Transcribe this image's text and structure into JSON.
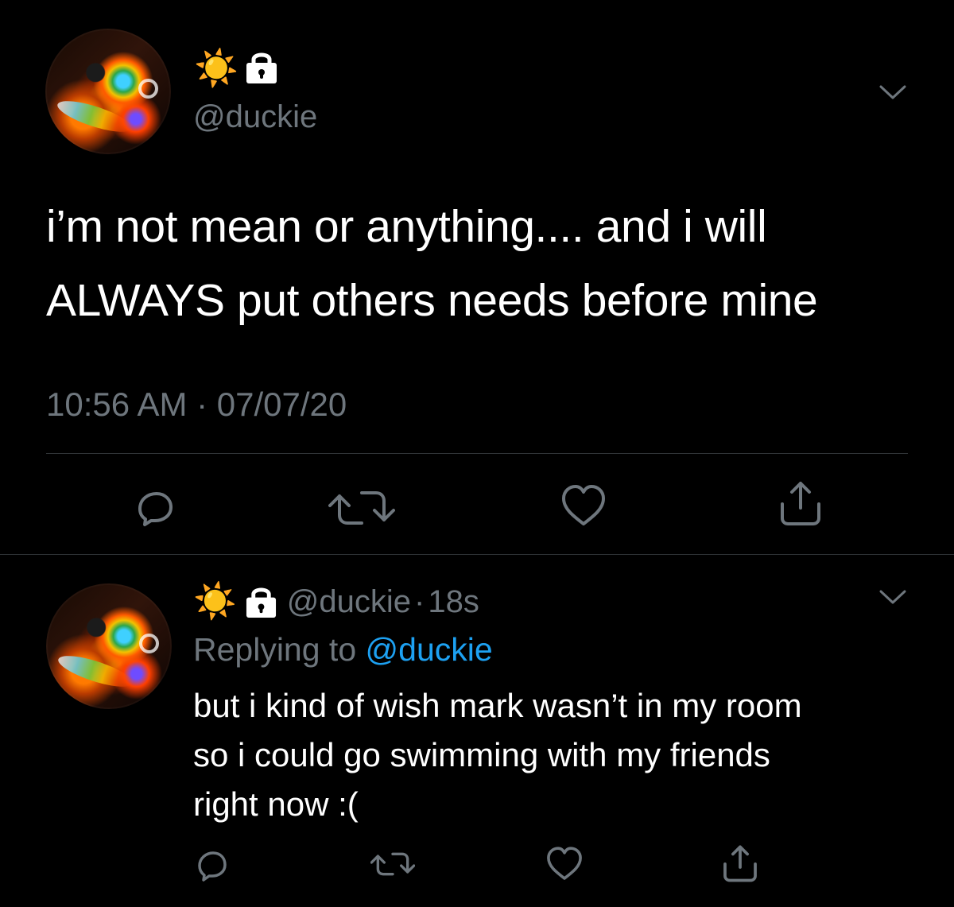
{
  "tweet": {
    "handle": "@duckie",
    "text_line_1": "i’m not mean or anything.... and i will",
    "text_line_2": "ALWAYS put others needs before mine",
    "timestamp": "10:56 AM · 07/07/20"
  },
  "reply": {
    "handle": "@duckie",
    "age": "18s",
    "replying_prefix": "Replying to",
    "replying_handle": "@duckie",
    "text_line_1": "but i kind of wish mark wasn’t in my room",
    "text_line_2": "so i could go swimming with my friends",
    "text_line_3": "right now :("
  },
  "colors": {
    "background": "#000000",
    "text": "#ffffff",
    "muted": "#6e767d",
    "link": "#1da1f2",
    "divider": "#2f3336"
  },
  "icons": {
    "sun": "sun-emoji",
    "lock": "lock-icon",
    "caret": "chevron-down-icon",
    "reply": "reply-icon",
    "retweet": "retweet-icon",
    "like": "heart-icon",
    "share": "share-icon"
  }
}
